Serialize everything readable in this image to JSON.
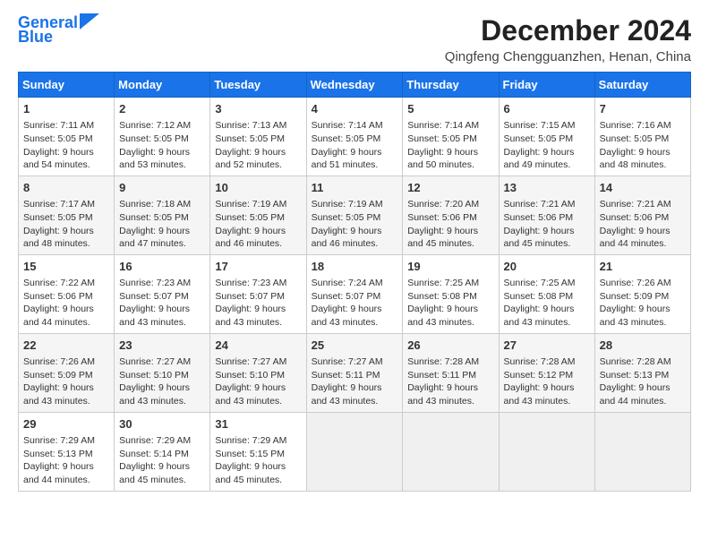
{
  "logo": {
    "line1": "General",
    "line2": "Blue"
  },
  "title": "December 2024",
  "location": "Qingfeng Chengguanzhen, Henan, China",
  "days_of_week": [
    "Sunday",
    "Monday",
    "Tuesday",
    "Wednesday",
    "Thursday",
    "Friday",
    "Saturday"
  ],
  "weeks": [
    [
      {
        "day": 1,
        "info": "Sunrise: 7:11 AM\nSunset: 5:05 PM\nDaylight: 9 hours and 54 minutes."
      },
      {
        "day": 2,
        "info": "Sunrise: 7:12 AM\nSunset: 5:05 PM\nDaylight: 9 hours and 53 minutes."
      },
      {
        "day": 3,
        "info": "Sunrise: 7:13 AM\nSunset: 5:05 PM\nDaylight: 9 hours and 52 minutes."
      },
      {
        "day": 4,
        "info": "Sunrise: 7:14 AM\nSunset: 5:05 PM\nDaylight: 9 hours and 51 minutes."
      },
      {
        "day": 5,
        "info": "Sunrise: 7:14 AM\nSunset: 5:05 PM\nDaylight: 9 hours and 50 minutes."
      },
      {
        "day": 6,
        "info": "Sunrise: 7:15 AM\nSunset: 5:05 PM\nDaylight: 9 hours and 49 minutes."
      },
      {
        "day": 7,
        "info": "Sunrise: 7:16 AM\nSunset: 5:05 PM\nDaylight: 9 hours and 48 minutes."
      }
    ],
    [
      {
        "day": 8,
        "info": "Sunrise: 7:17 AM\nSunset: 5:05 PM\nDaylight: 9 hours and 48 minutes."
      },
      {
        "day": 9,
        "info": "Sunrise: 7:18 AM\nSunset: 5:05 PM\nDaylight: 9 hours and 47 minutes."
      },
      {
        "day": 10,
        "info": "Sunrise: 7:19 AM\nSunset: 5:05 PM\nDaylight: 9 hours and 46 minutes."
      },
      {
        "day": 11,
        "info": "Sunrise: 7:19 AM\nSunset: 5:05 PM\nDaylight: 9 hours and 46 minutes."
      },
      {
        "day": 12,
        "info": "Sunrise: 7:20 AM\nSunset: 5:06 PM\nDaylight: 9 hours and 45 minutes."
      },
      {
        "day": 13,
        "info": "Sunrise: 7:21 AM\nSunset: 5:06 PM\nDaylight: 9 hours and 45 minutes."
      },
      {
        "day": 14,
        "info": "Sunrise: 7:21 AM\nSunset: 5:06 PM\nDaylight: 9 hours and 44 minutes."
      }
    ],
    [
      {
        "day": 15,
        "info": "Sunrise: 7:22 AM\nSunset: 5:06 PM\nDaylight: 9 hours and 44 minutes."
      },
      {
        "day": 16,
        "info": "Sunrise: 7:23 AM\nSunset: 5:07 PM\nDaylight: 9 hours and 43 minutes."
      },
      {
        "day": 17,
        "info": "Sunrise: 7:23 AM\nSunset: 5:07 PM\nDaylight: 9 hours and 43 minutes."
      },
      {
        "day": 18,
        "info": "Sunrise: 7:24 AM\nSunset: 5:07 PM\nDaylight: 9 hours and 43 minutes."
      },
      {
        "day": 19,
        "info": "Sunrise: 7:25 AM\nSunset: 5:08 PM\nDaylight: 9 hours and 43 minutes."
      },
      {
        "day": 20,
        "info": "Sunrise: 7:25 AM\nSunset: 5:08 PM\nDaylight: 9 hours and 43 minutes."
      },
      {
        "day": 21,
        "info": "Sunrise: 7:26 AM\nSunset: 5:09 PM\nDaylight: 9 hours and 43 minutes."
      }
    ],
    [
      {
        "day": 22,
        "info": "Sunrise: 7:26 AM\nSunset: 5:09 PM\nDaylight: 9 hours and 43 minutes."
      },
      {
        "day": 23,
        "info": "Sunrise: 7:27 AM\nSunset: 5:10 PM\nDaylight: 9 hours and 43 minutes."
      },
      {
        "day": 24,
        "info": "Sunrise: 7:27 AM\nSunset: 5:10 PM\nDaylight: 9 hours and 43 minutes."
      },
      {
        "day": 25,
        "info": "Sunrise: 7:27 AM\nSunset: 5:11 PM\nDaylight: 9 hours and 43 minutes."
      },
      {
        "day": 26,
        "info": "Sunrise: 7:28 AM\nSunset: 5:11 PM\nDaylight: 9 hours and 43 minutes."
      },
      {
        "day": 27,
        "info": "Sunrise: 7:28 AM\nSunset: 5:12 PM\nDaylight: 9 hours and 43 minutes."
      },
      {
        "day": 28,
        "info": "Sunrise: 7:28 AM\nSunset: 5:13 PM\nDaylight: 9 hours and 44 minutes."
      }
    ],
    [
      {
        "day": 29,
        "info": "Sunrise: 7:29 AM\nSunset: 5:13 PM\nDaylight: 9 hours and 44 minutes."
      },
      {
        "day": 30,
        "info": "Sunrise: 7:29 AM\nSunset: 5:14 PM\nDaylight: 9 hours and 45 minutes."
      },
      {
        "day": 31,
        "info": "Sunrise: 7:29 AM\nSunset: 5:15 PM\nDaylight: 9 hours and 45 minutes."
      },
      null,
      null,
      null,
      null
    ]
  ]
}
